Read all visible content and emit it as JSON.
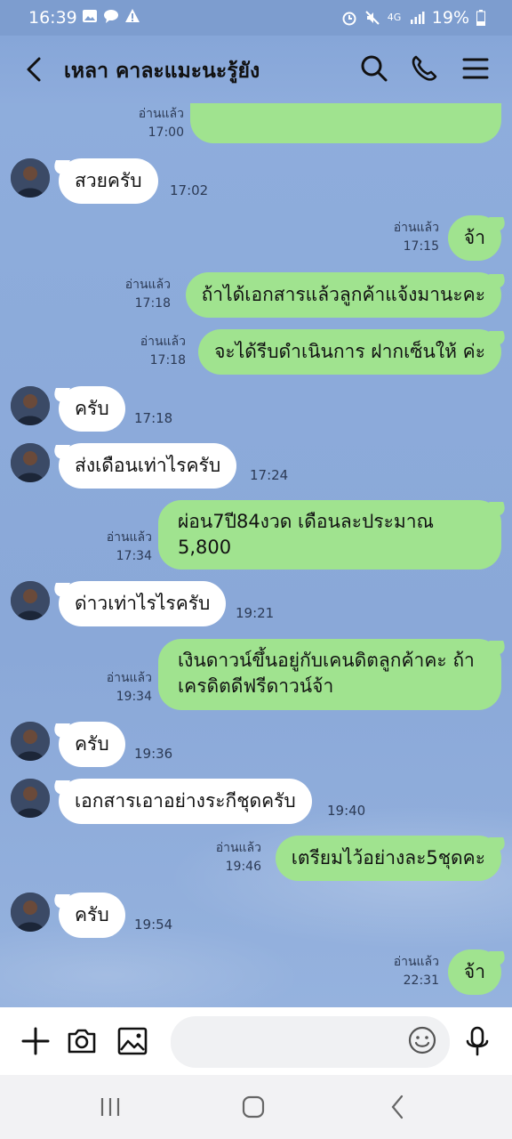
{
  "status": {
    "time": "16:39",
    "network": "4G",
    "battery": "19%",
    "icons": [
      "image-icon",
      "chat-bubble-icon",
      "warning-icon",
      "alarm-icon",
      "mute-icon",
      "signal-icon",
      "battery-icon"
    ]
  },
  "header": {
    "title": "เหลา คาละแมะนะรู้ยัง"
  },
  "messages": [
    {
      "side": "out",
      "text": "",
      "read": "อ่านแล้ว",
      "time": "17:00"
    },
    {
      "side": "in",
      "text": "สวยครับ",
      "time": "17:02"
    },
    {
      "side": "out",
      "text": "จ้า",
      "read": "อ่านแล้ว",
      "time": "17:15"
    },
    {
      "side": "out",
      "text": "ถ้าได้เอกสารแล้วลูกค้าแจ้งมานะคะ",
      "read": "อ่านแล้ว",
      "time": "17:18"
    },
    {
      "side": "out",
      "text": "จะได้รีบดำเนินการ ฝากเซ็นให้ ค่ะ",
      "read": "อ่านแล้ว",
      "time": "17:18"
    },
    {
      "side": "in",
      "text": "ครับ",
      "time": "17:18"
    },
    {
      "side": "in",
      "text": "ส่งเดือนเท่าไรครับ",
      "time": "17:24"
    },
    {
      "side": "out",
      "text": "ผ่อน7ปี84งวด เดือนละประมาณ 5,800",
      "read": "อ่านแล้ว",
      "time": "17:34"
    },
    {
      "side": "in",
      "text": "ด่าวเท่าไรไรครับ",
      "time": "19:21"
    },
    {
      "side": "out",
      "text": "เงินดาวน์ขึ้นอยู่กับเคนดิตลูกค้าคะ ถ้าเครดิตดีฟรีดาวน์จ้า",
      "read": "อ่านแล้ว",
      "time": "19:34"
    },
    {
      "side": "in",
      "text": "ครับ",
      "time": "19:36"
    },
    {
      "side": "in",
      "text": "เอกสารเอาอย่างระกีชุดครับ",
      "time": "19:40"
    },
    {
      "side": "out",
      "text": "เตรียมไว้อย่างละ5ชุดคะ",
      "read": "อ่านแล้ว",
      "time": "19:46"
    },
    {
      "side": "in",
      "text": "ครับ",
      "time": "19:54"
    },
    {
      "side": "out",
      "text": "จ้า",
      "read": "อ่านแล้ว",
      "time": "22:31"
    }
  ],
  "input": {
    "placeholder": ""
  },
  "colors": {
    "outgoing": "#a0e38f",
    "incoming": "#ffffff",
    "background": "#8daad9"
  }
}
